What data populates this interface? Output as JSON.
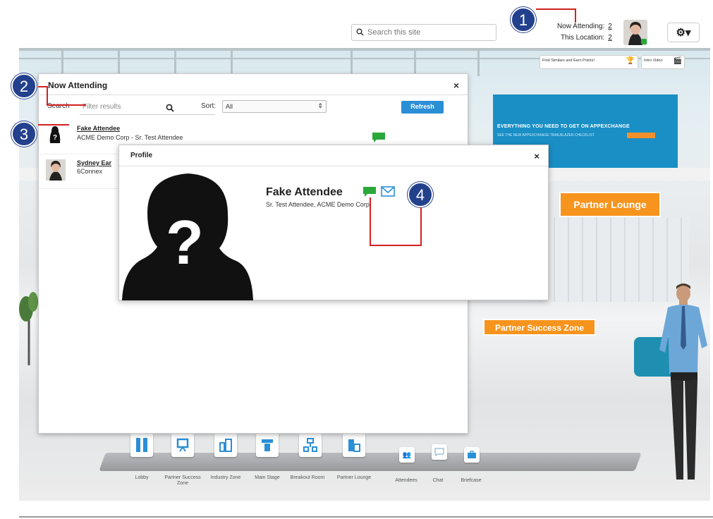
{
  "header": {
    "search_placeholder": "Search this site",
    "now_attending_label": "Now Attending:",
    "now_attending_value": "2",
    "this_location_label": "This Location:",
    "this_location_value": "2",
    "settings_caret": "▾"
  },
  "scene": {
    "find_similars_label": "Find Similars and Earn Points!",
    "intro_video_label": "Intro Video",
    "screen_headline": "EVERYTHING YOU NEED TO GET ON APPEXCHANGE",
    "screen_sub": "SEE THE NEW APPEXCHANGE TRAILBLAZER CHECKLIST",
    "sign_lounge": "Partner Lounge",
    "sign_success": "Partner Success Zone"
  },
  "nav": {
    "items": [
      {
        "label": "Lobby"
      },
      {
        "label": "Partner Success Zone"
      },
      {
        "label": "Industry Zone"
      },
      {
        "label": "Main Stage"
      },
      {
        "label": "Breakout Room"
      },
      {
        "label": "Partner Lounge"
      },
      {
        "label": "Attendees"
      },
      {
        "label": "Chat"
      },
      {
        "label": "Briefcase"
      }
    ]
  },
  "attending": {
    "title": "Now Attending",
    "close": "×",
    "search_label": "Search",
    "filter_placeholder": "Filter results",
    "sort_label": "Sort:",
    "sort_value": "All",
    "refresh": "Refresh",
    "rows": [
      {
        "name": "Fake Attendee",
        "sub": "ACME Demo Corp - Sr. Test Attendee"
      },
      {
        "name": "Sydney Ear",
        "sub": "6Connex"
      }
    ]
  },
  "profile": {
    "title": "Profile",
    "close": "×",
    "name": "Fake Attendee",
    "subtitle": "Sr. Test Attendee, ACME Demo Corp"
  },
  "markers": [
    "1",
    "2",
    "3",
    "4"
  ],
  "colors": {
    "accent_blue": "#2b8fd6",
    "marker_navy": "#22408c",
    "annotation_red": "#d32020",
    "sign_orange": "#f7941d",
    "chat_green": "#2aa83a"
  }
}
